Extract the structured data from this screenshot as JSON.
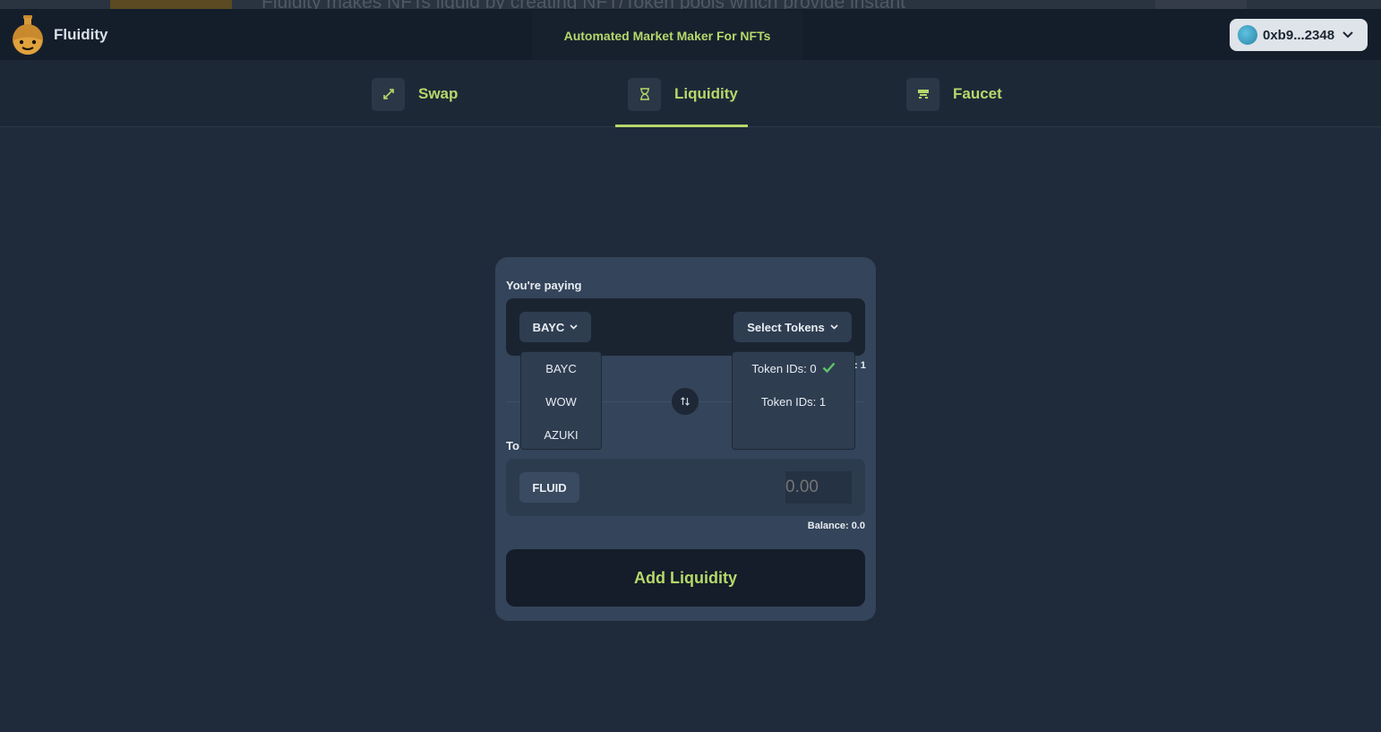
{
  "app": {
    "brand": "Fluidity",
    "tagline": "Automated Market Maker For NFTs",
    "wallet_address": "0xb9...2348",
    "background_text": "Fluidity makes NFTs liquid by creating NFT/Token pools which provide instant"
  },
  "tabs": [
    {
      "label": "Swap",
      "icon": "swap-arrows-icon",
      "active": false
    },
    {
      "label": "Liquidity",
      "icon": "hourglass-icon",
      "active": true
    },
    {
      "label": "Faucet",
      "icon": "faucet-icon",
      "active": false
    }
  ],
  "card": {
    "paying_label": "You're paying",
    "nft_selected": "BAYC",
    "select_tokens_label": "Select Tokens",
    "to_label": "To",
    "receive_token": "FLUID",
    "amount_placeholder": "0.00",
    "balance": "Balance: 0.0",
    "action_label": "Add Liquidity"
  },
  "nft_dropdown": {
    "options": [
      "BAYC",
      "WOW",
      "AZUKI"
    ]
  },
  "token_dropdown": {
    "options": [
      {
        "label": "Token IDs: 0",
        "checked": true
      },
      {
        "label": "Token IDs: 1",
        "checked": false
      }
    ],
    "peek_text": ": 1"
  },
  "colors": {
    "accent": "#b6d86a",
    "background": "#1f2a3a",
    "card": "#34445a",
    "check": "#5fc46a"
  }
}
